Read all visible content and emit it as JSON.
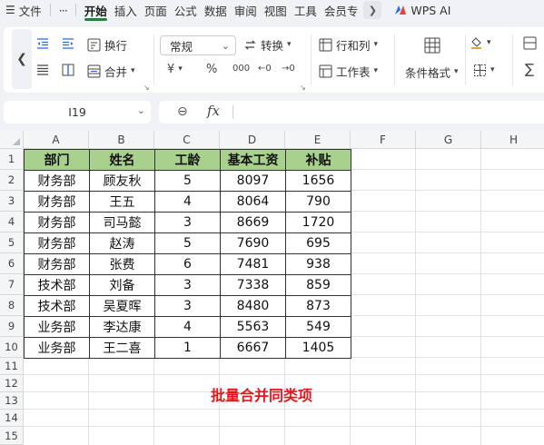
{
  "menubar": {
    "menu_icon": "hamburger-icon",
    "file": "文件",
    "more": "···",
    "tabs": [
      "开始",
      "插入",
      "页面",
      "公式",
      "数据",
      "审阅",
      "视图",
      "工具",
      "会员专"
    ],
    "active_tab": "开始",
    "ai_label": "WPS AI"
  },
  "ribbon": {
    "wrap_label": "换行",
    "merge_label": "合并",
    "number_format": "常规",
    "convert_label": "转换",
    "row_col_label": "行和列",
    "worksheet_label": "工作表",
    "conditional_format_label": "条件格式",
    "currency_symbol": "¥",
    "percent_symbol": "%",
    "thousands_symbol": "000",
    "increase_decimal_symbol": "←0",
    "decrease_decimal_symbol": "→0"
  },
  "formula_bar": {
    "name_box": "I19",
    "fx_label": "fx",
    "formula": ""
  },
  "sheet": {
    "columns": [
      "A",
      "B",
      "C",
      "D",
      "E",
      "F",
      "G",
      "H"
    ],
    "rows": [
      "1",
      "2",
      "3",
      "4",
      "5",
      "6",
      "7",
      "8",
      "9",
      "10",
      "11",
      "12",
      "13",
      "14",
      "15"
    ],
    "header_color": "#a9d18e",
    "table": {
      "headers": [
        "部门",
        "姓名",
        "工龄",
        "基本工资",
        "补贴"
      ],
      "rows": [
        [
          "财务部",
          "顾友秋",
          "5",
          "8097",
          "1656"
        ],
        [
          "财务部",
          "王五",
          "4",
          "8064",
          "790"
        ],
        [
          "财务部",
          "司马懿",
          "3",
          "8669",
          "1720"
        ],
        [
          "财务部",
          "赵涛",
          "5",
          "7690",
          "695"
        ],
        [
          "财务部",
          "张费",
          "6",
          "7481",
          "938"
        ],
        [
          "技术部",
          "刘备",
          "3",
          "7338",
          "859"
        ],
        [
          "技术部",
          "吴夏晖",
          "3",
          "8480",
          "873"
        ],
        [
          "业务部",
          "李达康",
          "4",
          "5563",
          "549"
        ],
        [
          "业务部",
          "王二喜",
          "1",
          "6667",
          "1405"
        ]
      ]
    },
    "note": "批量合并同类项",
    "note_color": "#e8141c"
  }
}
